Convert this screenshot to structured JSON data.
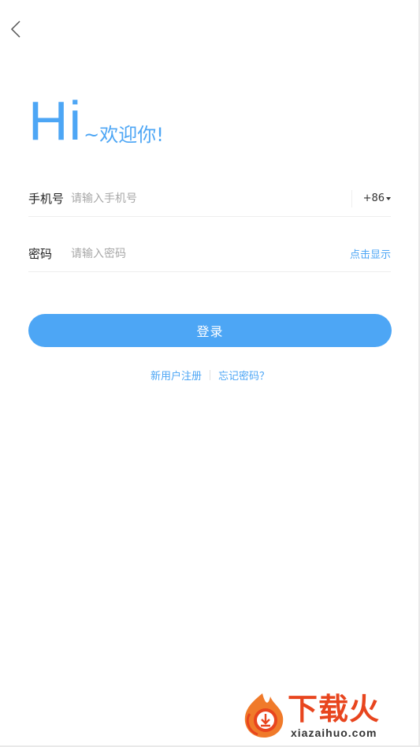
{
  "greeting": {
    "hi": "Hi",
    "welcome": "~欢迎你!"
  },
  "phone": {
    "label": "手机号",
    "placeholder": "请输入手机号",
    "country_code": "+86"
  },
  "password": {
    "label": "密码",
    "placeholder": "请输入密码",
    "show_label": "点击显示"
  },
  "login_button": "登录",
  "links": {
    "register": "新用户注册",
    "forgot": "忘记密码？"
  },
  "watermark": {
    "cn": "下载火",
    "en": "xiazaihuo.com"
  },
  "colors": {
    "accent": "#4da6f5",
    "watermark": "#e8451e"
  },
  "icons": {
    "back": "chevron-left-icon",
    "country_dropdown": "caret-down-icon",
    "watermark": "flame-download-logo"
  }
}
